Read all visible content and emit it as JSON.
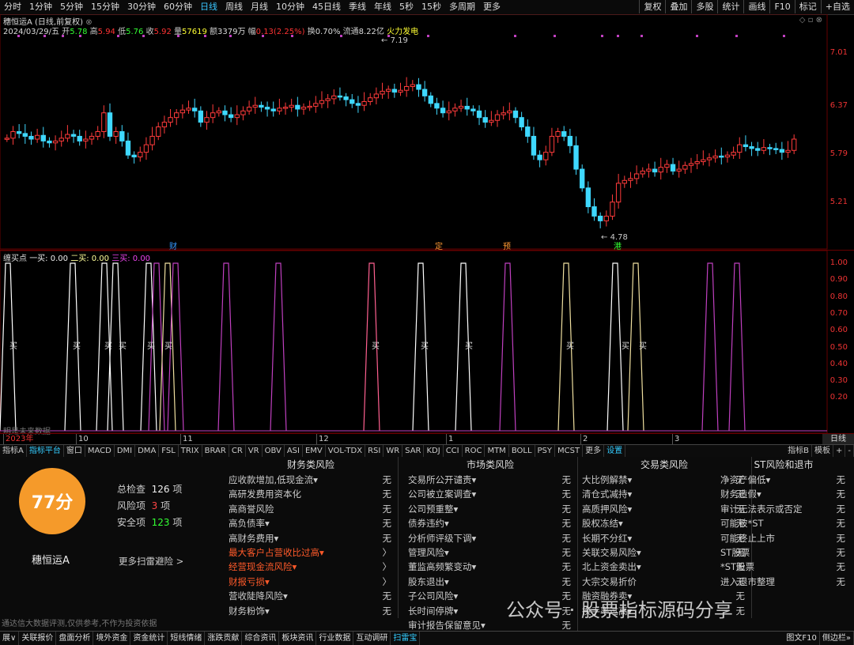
{
  "period_bar": {
    "items": [
      "分时",
      "1分钟",
      "5分钟",
      "15分钟",
      "30分钟",
      "60分钟",
      "日线",
      "周线",
      "月线",
      "10分钟",
      "45日线",
      "季线",
      "年线",
      "5秒",
      "15秒",
      "多周期",
      "更多"
    ],
    "active_index": 6,
    "right_items": [
      "复权",
      "叠加",
      "多股",
      "统计",
      "画线",
      "F10",
      "标记",
      "+自选"
    ]
  },
  "kline": {
    "title": "穗恒运A (日线,前复权)",
    "date_label": "2024/03/29/五",
    "open_label": "开",
    "open": "5.78",
    "high_label": "高",
    "high": "5.94",
    "low_label": "低",
    "low": "5.76",
    "close_label": "收",
    "close": "5.92",
    "volume_label": "量",
    "volume": "57619",
    "amount_label": "额",
    "amount": "3379万",
    "change_label": "幅",
    "change": "0.13(2.25%)",
    "turnover_label": "换",
    "turnover": "0.70%",
    "float_label": "流通",
    "float": "8.22亿",
    "tag": "火力发电",
    "y_ticks": [
      "7.01",
      "6.37",
      "5.79",
      "5.21"
    ],
    "high_marker": "7.19",
    "low_marker": "4.78",
    "event_markers": [
      "财",
      "定",
      "预",
      "港"
    ]
  },
  "indicator": {
    "title": "缠买点",
    "b1_label": "一买:",
    "b1_value": "0.00",
    "b2_label": "二买:",
    "b2_value": "0.00",
    "b3_label": "三买:",
    "b3_value": "0.00",
    "y_ticks": [
      "1.00",
      "0.90",
      "0.80",
      "0.70",
      "0.60",
      "0.50",
      "0.40",
      "0.30",
      "0.20"
    ],
    "buy_label": "买",
    "corner_note": "明是未来数据"
  },
  "time_axis": {
    "labels": [
      "2023年",
      "10",
      "11",
      "12",
      "1",
      "2",
      "3"
    ],
    "right_label": "日线"
  },
  "indicator_tabs": {
    "items": [
      "指标A",
      "指标平台",
      "窗口",
      "MACD",
      "DMI",
      "DMA",
      "FSL",
      "TRIX",
      "BRAR",
      "CR",
      "VR",
      "OBV",
      "ASI",
      "EMV",
      "VOL-TDX",
      "RSI",
      "WR",
      "SAR",
      "KDJ",
      "CCI",
      "ROC",
      "MTM",
      "BOLL",
      "PSY",
      "MCST",
      "更多",
      "设置"
    ],
    "right_items": [
      "指标B",
      "模板",
      "+",
      "-"
    ]
  },
  "risk": {
    "score": "77分",
    "name": "穗恒运A",
    "total_label": "总检查",
    "total": "126",
    "total_unit": "项",
    "risk_label": "风险项",
    "risk": "3",
    "risk_unit": "项",
    "safe_label": "安全项",
    "safe": "123",
    "safe_unit": "项",
    "more_link": "更多扫雷避险 >",
    "disclaimer": "通达信大数据评测,仅供参考,不作为投资依据",
    "columns": [
      {
        "title": "财务类风险",
        "rows": [
          {
            "label": "应收款增加,低现金流▾",
            "status": "无",
            "red": false
          },
          {
            "label": "高研发费用资本化",
            "status": "无",
            "red": false
          },
          {
            "label": "高商誉风险",
            "status": "无",
            "red": false
          },
          {
            "label": "高负债率▾",
            "status": "无",
            "red": false
          },
          {
            "label": "高财务费用▾",
            "status": "无",
            "red": false
          },
          {
            "label": "最大客户占营收比过高▾",
            "status": "〉",
            "red": true
          },
          {
            "label": "经营现金流风险▾",
            "status": "〉",
            "red": true
          },
          {
            "label": "财报亏损▾",
            "status": "〉",
            "red": true
          },
          {
            "label": "营收陡降风险▾",
            "status": "无",
            "red": false
          },
          {
            "label": "财务粉饰▾",
            "status": "无",
            "red": false
          }
        ]
      },
      {
        "title": "市场类风险",
        "rows": [
          {
            "label": "交易所公开谴责▾",
            "status": "无",
            "red": false
          },
          {
            "label": "公司被立案调查▾",
            "status": "无",
            "red": false
          },
          {
            "label": "公司预重整▾",
            "status": "无",
            "red": false
          },
          {
            "label": "债券违约▾",
            "status": "无",
            "red": false
          },
          {
            "label": "分析师评级下调▾",
            "status": "无",
            "red": false
          },
          {
            "label": "管理风险▾",
            "status": "无",
            "red": false
          },
          {
            "label": "董监高频繁变动▾",
            "status": "无",
            "red": false
          },
          {
            "label": "股东退出▾",
            "status": "无",
            "red": false
          },
          {
            "label": "子公司风险▾",
            "status": "无",
            "red": false
          },
          {
            "label": "长时间停牌▾",
            "status": "无",
            "red": false
          },
          {
            "label": "审计报告保留意见▾",
            "status": "无",
            "red": false
          }
        ]
      },
      {
        "title": "交易类风险",
        "rows": [
          {
            "label": "大比例解禁▾",
            "status": "无",
            "red": false
          },
          {
            "label": "清仓式减持▾",
            "status": "无",
            "red": false
          },
          {
            "label": "高质押风险▾",
            "status": "无",
            "red": false
          },
          {
            "label": "股权冻结▾",
            "status": "无",
            "red": false
          },
          {
            "label": "长期不分红▾",
            "status": "无",
            "red": false
          },
          {
            "label": "关联交易风险▾",
            "status": "无",
            "red": false
          },
          {
            "label": "北上资金卖出▾",
            "status": "无",
            "red": false
          },
          {
            "label": "大宗交易折价",
            "status": "无",
            "red": false
          },
          {
            "label": "融资融券卖▾",
            "status": "无",
            "red": false
          },
          {
            "label": "换手率过高▾",
            "status": "无",
            "red": false
          }
        ]
      },
      {
        "title": "ST风险和退市",
        "rows": [
          {
            "label": "净资产偏低▾",
            "status": "无",
            "red": false
          },
          {
            "label": "财务造假▾",
            "status": "无",
            "red": false
          },
          {
            "label": "审计无法表示或否定",
            "status": "无",
            "red": false
          },
          {
            "label": "可能被*ST",
            "status": "无",
            "red": false
          },
          {
            "label": "可能终止上市",
            "status": "无",
            "red": false
          },
          {
            "label": "ST股票",
            "status": "无",
            "red": false
          },
          {
            "label": "*ST股票",
            "status": "无",
            "red": false
          },
          {
            "label": "进入退市整理",
            "status": "无",
            "red": false
          }
        ]
      }
    ]
  },
  "bottom_bar": {
    "items": [
      "展∨",
      "关联报价",
      "盘面分析",
      "境外资金",
      "资金统计",
      "短线情绪",
      "涨跌贡献",
      "综合资讯",
      "板块资讯",
      "行业数据",
      "互动调研",
      "扫雷宝"
    ],
    "active_index": 11,
    "right_items": [
      "图文F10",
      "侧边栏»"
    ]
  },
  "watermark": "公众号 · 股票指标源码分享",
  "colors": {
    "up": "#ff3b3b",
    "down": "#3fd8ff",
    "accent": "#39c6ff",
    "score": "#f59a2a",
    "magenta": "#c040c0",
    "pale": "#f0e0a0"
  }
}
